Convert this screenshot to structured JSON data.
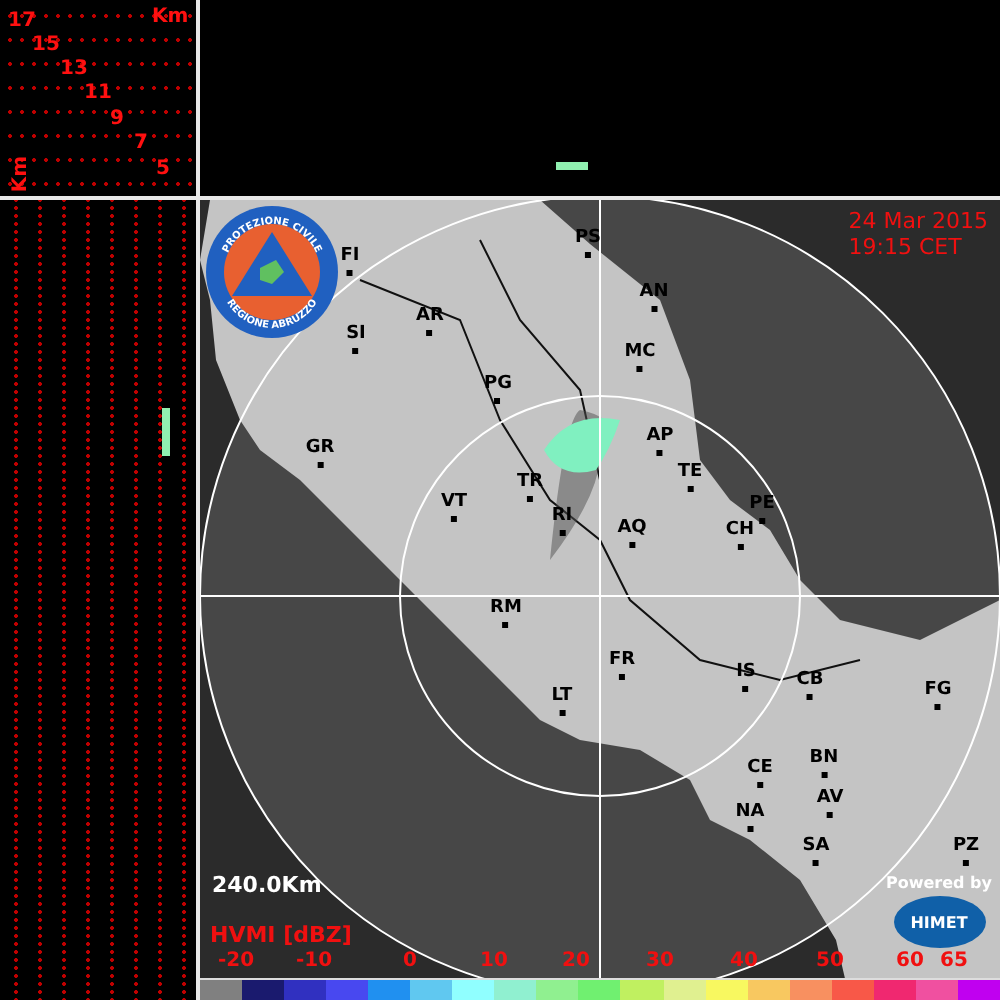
{
  "vertical_profile": {
    "unit_top": "Km",
    "unit_side": "Km",
    "scale_labels": [
      "17",
      "15",
      "13",
      "11",
      "9",
      "7",
      "5"
    ]
  },
  "map": {
    "date": "24 Mar 2015",
    "time": "19:15 CET",
    "range": "240.0Km",
    "cities": [
      "FI",
      "SI",
      "AR",
      "PS",
      "AN",
      "MC",
      "PG",
      "GR",
      "AP",
      "TE",
      "TR",
      "VT",
      "RI",
      "PE",
      "CH",
      "AQ",
      "RM",
      "FR",
      "LT",
      "IS",
      "CB",
      "FG",
      "CE",
      "BN",
      "AV",
      "NA",
      "SA",
      "PZ"
    ]
  },
  "logo": {
    "top_text": "PROTEZIONE CIVILE",
    "bottom_text": "REGIONE ABRUZZO"
  },
  "credit": {
    "caption": "Powered by",
    "brand": "HIMET"
  },
  "legend": {
    "title": "HVMI [dBZ]",
    "ticks": [
      "-20",
      "-10",
      "0",
      "10",
      "20",
      "30",
      "40",
      "50",
      "60",
      "65"
    ],
    "swatches": [
      {
        "color": "#808080"
      },
      {
        "color": "#1a1a6e"
      },
      {
        "color": "#3030c0"
      },
      {
        "color": "#4848f0"
      },
      {
        "color": "#2090f0"
      },
      {
        "color": "#60c8f0"
      },
      {
        "color": "#90ffff"
      },
      {
        "color": "#90f0d0"
      },
      {
        "color": "#90f090"
      },
      {
        "color": "#70f070"
      },
      {
        "color": "#c0f060"
      },
      {
        "color": "#e0f090"
      },
      {
        "color": "#f8f860"
      },
      {
        "color": "#f8c860"
      },
      {
        "color": "#f89060"
      },
      {
        "color": "#f85848"
      },
      {
        "color": "#f02870"
      },
      {
        "color": "#f050a0"
      },
      {
        "color": "#c000f0"
      }
    ]
  }
}
